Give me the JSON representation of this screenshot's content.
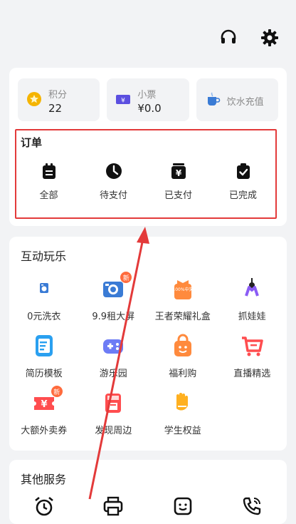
{
  "topbar": {
    "icons": [
      "headset-icon",
      "gear-icon"
    ]
  },
  "tiles": [
    {
      "label": "积分",
      "value": "22",
      "icon": "coin-icon",
      "color": "#f5b400"
    },
    {
      "label": "小票",
      "value": "¥0.0",
      "icon": "ticket-icon",
      "color": "#5b4fe0"
    },
    {
      "label": "饮水充值",
      "icon": "water-cup-icon",
      "color": "#3a7bd5"
    }
  ],
  "orders": {
    "title": "订单",
    "items": [
      {
        "label": "全部",
        "icon": "clipboard-icon"
      },
      {
        "label": "待支付",
        "icon": "clock-icon"
      },
      {
        "label": "已支付",
        "icon": "yen-card-icon"
      },
      {
        "label": "已完成",
        "icon": "check-clipboard-icon"
      }
    ]
  },
  "fun": {
    "title": "互动玩乐",
    "items": [
      {
        "label": "0元洗衣",
        "icon": "washer-icon"
      },
      {
        "label": "9.9租大屏",
        "icon": "camera-icon",
        "badge": "新"
      },
      {
        "label": "王者荣耀礼盒",
        "icon": "gift-box-icon",
        "sub": "100%中奖"
      },
      {
        "label": "抓娃娃",
        "icon": "claw-icon"
      },
      {
        "label": "简历模板",
        "icon": "resume-icon"
      },
      {
        "label": "游乐园",
        "icon": "gamepad-icon"
      },
      {
        "label": "福利购",
        "icon": "shopping-bag-icon"
      },
      {
        "label": "直播精选",
        "icon": "cart-icon"
      },
      {
        "label": "大额外卖券",
        "icon": "yen-coupon-icon",
        "badge": "新"
      },
      {
        "label": "发现周边",
        "icon": "store-icon"
      },
      {
        "label": "学生权益",
        "icon": "hand-icon"
      }
    ]
  },
  "other": {
    "title": "其他服务",
    "icons": [
      "alarm-icon",
      "printer-icon",
      "face-icon",
      "phone-icon"
    ]
  },
  "colors": {
    "highlight": "#e33a3a",
    "arrow": "#e33a3a",
    "accent": "#3a7bd5"
  }
}
